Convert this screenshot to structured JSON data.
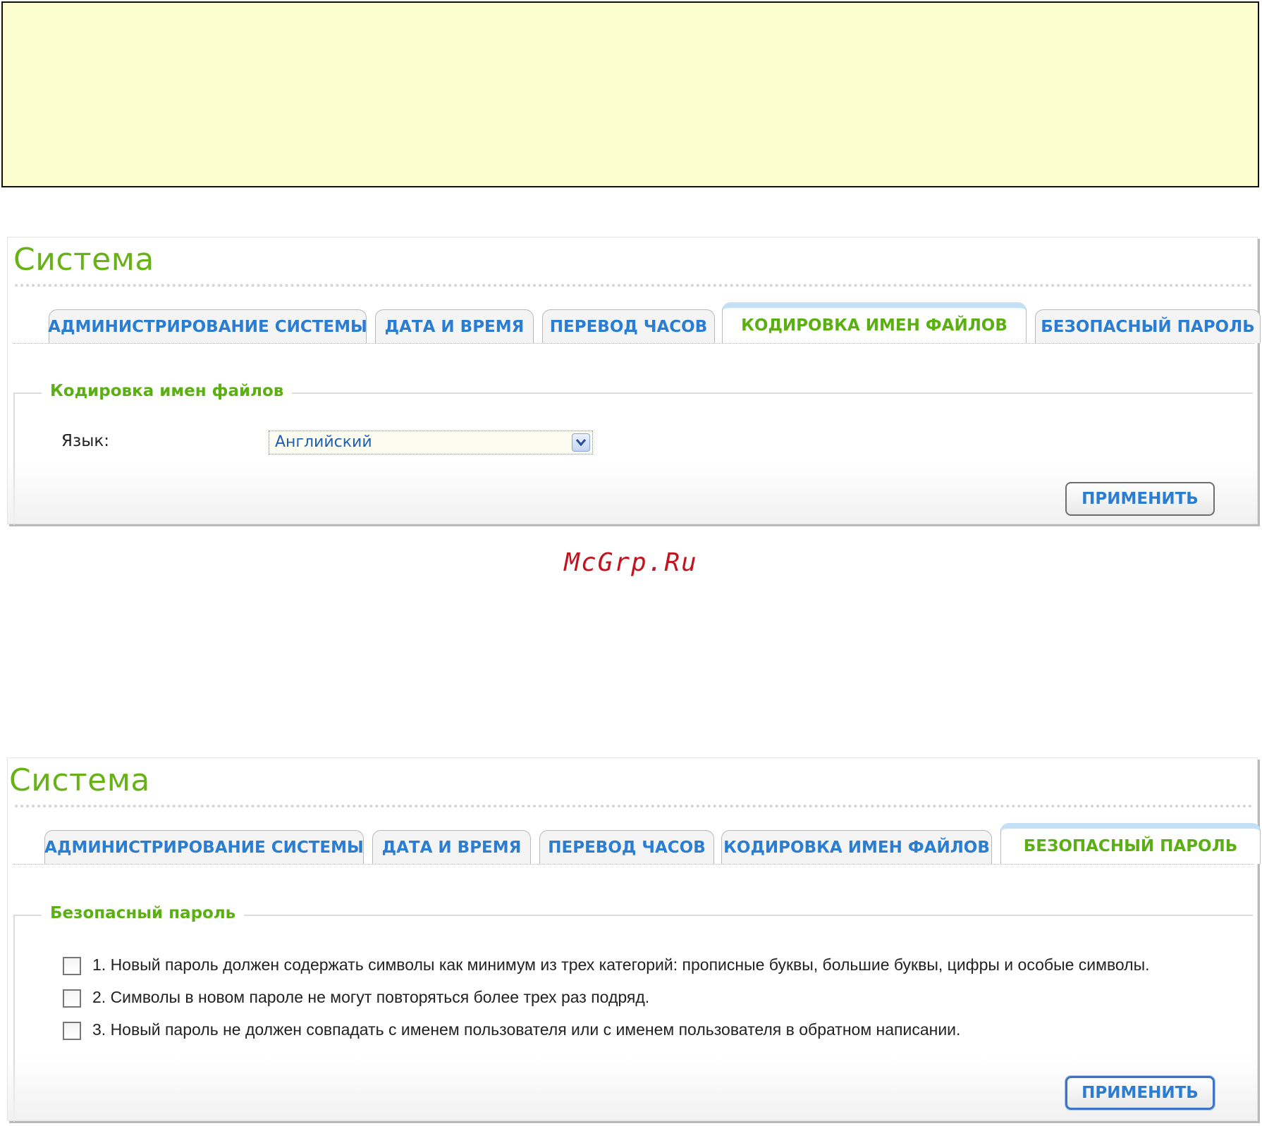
{
  "watermark": "McGrp.Ru",
  "panel1": {
    "title": "Система",
    "tabs": [
      {
        "label": "АДМИНИСТРИРОВАНИЕ СИСТЕМЫ",
        "active": false
      },
      {
        "label": "ДАТА И ВРЕМЯ",
        "active": false
      },
      {
        "label": "ПЕРЕВОД ЧАСОВ",
        "active": false
      },
      {
        "label": "КОДИРОВКА ИМЕН ФАЙЛОВ",
        "active": true
      },
      {
        "label": "БЕЗОПАСНЫЙ ПАРОЛЬ",
        "active": false
      }
    ],
    "section_legend": "Кодировка имен файлов",
    "language_label": "Язык:",
    "language_value": "Английский",
    "apply_label": "ПРИМЕНИТЬ"
  },
  "panel2": {
    "title": "Система",
    "tabs": [
      {
        "label": "АДМИНИСТРИРОВАНИЕ СИСТЕМЫ",
        "active": false
      },
      {
        "label": "ДАТА И ВРЕМЯ",
        "active": false
      },
      {
        "label": "ПЕРЕВОД ЧАСОВ",
        "active": false
      },
      {
        "label": "КОДИРОВКА ИМЕН ФАЙЛОВ",
        "active": false
      },
      {
        "label": "БЕЗОПАСНЫЙ ПАРОЛЬ",
        "active": true
      }
    ],
    "section_legend": "Безопасный пароль",
    "rules": [
      {
        "text": "1. Новый пароль должен содержать символы как минимум из трех категорий: прописные буквы, большие буквы, цифры и особые символы.",
        "checked": false
      },
      {
        "text": "2. Символы в новом пароле не могут повторяться более трех раз подряд.",
        "checked": false
      },
      {
        "text": "3. Новый пароль не должен совпадать с именем пользователя или с именем пользователя в обратном написании.",
        "checked": false
      }
    ],
    "apply_label": "ПРИМЕНИТЬ"
  }
}
